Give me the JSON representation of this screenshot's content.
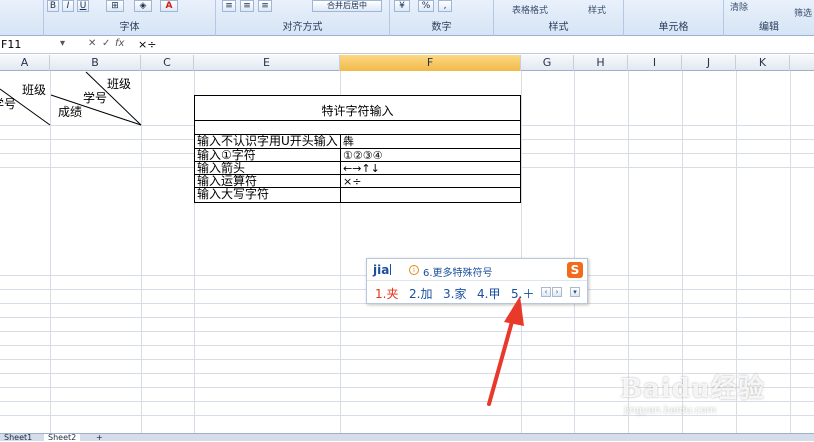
{
  "ribbon": {
    "groups": [
      {
        "label": "字体"
      },
      {
        "label": "对齐方式"
      },
      {
        "label": "数字"
      },
      {
        "label": "样式"
      },
      {
        "label": "单元格"
      },
      {
        "label": "编辑"
      }
    ],
    "bold": "B",
    "italic": "I",
    "underline": "U",
    "percent": "%",
    "comma": ",",
    "table_format": "表格格式",
    "cell_style": "样式",
    "merge_center": "合并后居中",
    "clear": "清除",
    "sort_filter": "筛选"
  },
  "formula_bar": {
    "name_box": "F11",
    "content": "×÷"
  },
  "columns": [
    "A",
    "B",
    "C",
    "E",
    "F",
    "G",
    "H",
    "I",
    "J",
    "K"
  ],
  "selected_column": "F",
  "header_cells": {
    "a_label": "学号",
    "a_label2": "班级",
    "b_class": "班级",
    "b_student_no": "学号",
    "b_score": "成绩"
  },
  "table": {
    "title": "特许字符输入",
    "rows": [
      {
        "label": "输入不认识字用U开头输入",
        "value": "犇"
      },
      {
        "label": "输入①字符",
        "value": "①②③④"
      },
      {
        "label": "输入箭头",
        "value": "←→↑↓"
      },
      {
        "label": "输入运算符",
        "value": "×÷"
      },
      {
        "label": "输入大写字符",
        "value": ""
      }
    ]
  },
  "ime": {
    "pinyin": "jia",
    "more_symbols": "6.更多特殊符号",
    "logo": "S",
    "candidates": [
      "1.夹",
      "2.加",
      "3.家",
      "4.甲",
      "5.＋"
    ]
  },
  "sheets": [
    "Sheet1",
    "Sheet2"
  ],
  "watermark": {
    "main": "Baidu经验",
    "sub": "jingyan.baidu.com"
  },
  "colors": {
    "arrow": "#e8392b",
    "ribbon": "#d6e4f5",
    "selected_header": "#f3b94a"
  }
}
